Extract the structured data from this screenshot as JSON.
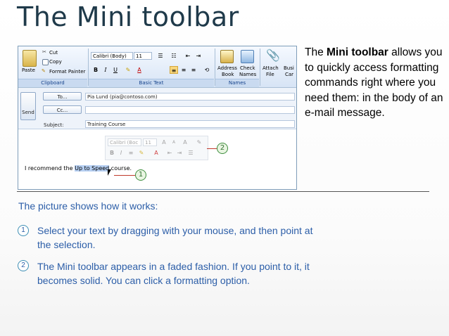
{
  "slide": {
    "title": "The Mini toolbar"
  },
  "screenshot": {
    "ribbon": {
      "paste": "Paste",
      "cut": "Cut",
      "copy": "Copy",
      "format_painter": "Format Painter",
      "font_name": "Calibri (Body)",
      "font_size": "11",
      "address_book_1": "Address",
      "address_book_2": "Book",
      "check_names_1": "Check",
      "check_names_2": "Names",
      "attach_1": "Attach",
      "attach_2": "File",
      "busi_1": "Busi",
      "busi_2": "Car",
      "group_clipboard": "Clipboard",
      "group_basic_text": "Basic Text",
      "group_names": "Names"
    },
    "header": {
      "send": "Send",
      "to_button": "To...",
      "cc_button": "Cc...",
      "subject_label": "Subject:",
      "to_value": "Pia Lund (pia@contoso.com)",
      "cc_value": "",
      "subject_value": "Training Course"
    },
    "mini_toolbar": {
      "font_name": "Calibri (Boc",
      "font_size": "11"
    },
    "body": {
      "before": "I recommend the ",
      "selected": "Up to Speed",
      "after": " course."
    },
    "callout_1": "1",
    "callout_2": "2"
  },
  "side": {
    "prefix": "The ",
    "bold": "Mini toolbar",
    "rest": " allows you to quickly access formatting commands right where you need them: in the body of an e-mail message."
  },
  "howto": {
    "intro": "The picture shows how it works:",
    "steps": [
      {
        "num": "1",
        "text": "Select your text by dragging with your mouse, and then point at the selection."
      },
      {
        "num": "2",
        "text": "The Mini toolbar appears in a faded fashion. If you point to it, it becomes solid. You can click a formatting option."
      }
    ]
  }
}
